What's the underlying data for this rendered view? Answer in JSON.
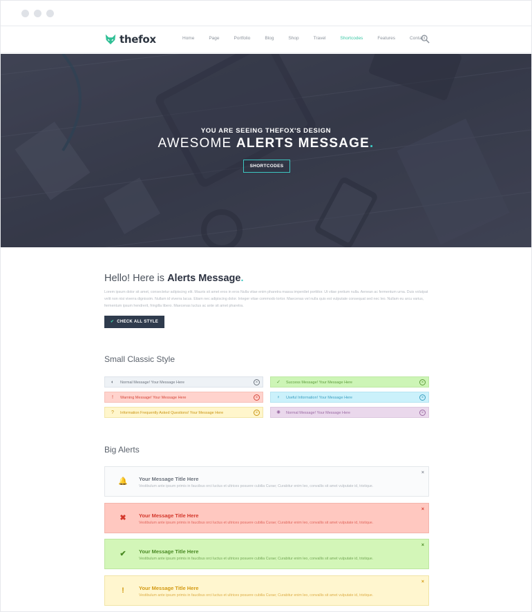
{
  "nav": {
    "logo_text": "thefox",
    "items": [
      "Home",
      "Page",
      "Portfolio",
      "Blog",
      "Shop",
      "Travel",
      "Shortcodes",
      "Features",
      "Contact"
    ],
    "active_index": 6
  },
  "hero": {
    "subtitle": "YOU ARE SEEING THEFOX'S DESIGN",
    "title_light": "AWESOME",
    "title_bold": "ALERTS MESSAGE",
    "title_dot": ".",
    "button_label": "SHORTCODES"
  },
  "intro": {
    "title_light": "Hello! Here is",
    "title_bold": "Alerts Message",
    "title_dot": ".",
    "text": "Lorem ipsum dolor sit amet, consectetur adipiscing elit. Mauris sit amet eros in eros Nulla vitae enim pharetra massa imperdiet porttitor. Ut vitae pretium nulla. Aenean ac fermentum urna. Duis volutpat velit non nisi viverra dignissim. Nullam id viverra lacus. Etiam nec adipiscing dolor. Integer vitae commodo tortor. Maecenas vel nulla quis est vulputate consequat sed nec leo. Nullam eu arcu varius, fermentum ipsum hendrerit, fringilla libero. Maecenas luctus ac ante sit amet pharetra.",
    "button_label": "CHECK ALL STYLE"
  },
  "small_section_title": "Small Classic Style",
  "small_alerts": [
    {
      "text": "Normal Message! Your Message Here",
      "icon": "speaker-icon",
      "bg": "#eef2f6",
      "border": "#dde3ea",
      "color": "#6b737d"
    },
    {
      "text": "Success Message! Your Message Here",
      "icon": "check-circle-icon",
      "bg": "#cdf5b6",
      "border": "#bde8a3",
      "color": "#5f9c3d"
    },
    {
      "text": "Warning Message! Your Message Here",
      "icon": "warning-circle-icon",
      "bg": "#ffd3cd",
      "border": "#f6c0b8",
      "color": "#d5463a"
    },
    {
      "text": "Useful Information! Your Message Here",
      "icon": "lightbulb-icon",
      "bg": "#cbf1fb",
      "border": "#b6e4f2",
      "color": "#3a9fc0"
    },
    {
      "text": "Information Frequently Asked Questions! Your Message Here",
      "icon": "question-icon",
      "bg": "#fff6cc",
      "border": "#f2e6a8",
      "color": "#c99414"
    },
    {
      "text": "Normal Message! Your Message Here",
      "icon": "gear-icon",
      "bg": "#ead8ec",
      "border": "#dcc7df",
      "color": "#9a6aa3"
    }
  ],
  "big_section_title": "Big Alerts",
  "big_alerts": [
    {
      "title": "Your Message Title Here",
      "text": "Vestibulum ante ipsum primis in faucibus orci luctus et ultrices posuere cubilia Curae; Curabitur enim leo, convallis sit amet vulputate id, tristique.",
      "icon": "bell-icon",
      "glyph": "🔔",
      "bg": "#fafbfc",
      "border": "#e4e7eb",
      "title_color": "#6a717b",
      "text_color": "#b0b6bd",
      "icon_color": "#8a9099",
      "close_color": "#8a9099"
    },
    {
      "title": "Your Message Title Here",
      "text": "Vestibulum ante ipsum primis in faucibus orci luctus et ultrices posuere cubilia Curae; Curabitur enim leo, convallis sit amet vulputate id, tristique.",
      "icon": "cross-icon",
      "glyph": "✖",
      "bg": "#ffc8c0",
      "border": "#f3b4ab",
      "title_color": "#d4382c",
      "text_color": "#e0665c",
      "icon_color": "#d4382c",
      "close_color": "#d4382c"
    },
    {
      "title": "Your Message Title Here",
      "text": "Vestibulum ante ipsum primis in faucibus orci luctus et ultrices posuere cubilia Curae; Curabitur enim leo, convallis sit amet vulputate id, tristique.",
      "icon": "check-icon",
      "glyph": "✔",
      "bg": "#d3f6b8",
      "border": "#bde6a0",
      "title_color": "#4a8a24",
      "text_color": "#74a855",
      "icon_color": "#4a8a24",
      "close_color": "#4a8a24"
    },
    {
      "title": "Your Message Title Here",
      "text": "Vestibulum ante ipsum primis in faucibus orci luctus et ultrices posuere cubilia Curae; Curabitur enim leo, convallis sit amet vulputate id, tristique.",
      "icon": "exclamation-icon",
      "glyph": "!",
      "bg": "#fff6cf",
      "border": "#f1e4a5",
      "title_color": "#d39a13",
      "text_color": "#ddae47",
      "icon_color": "#d39a13",
      "close_color": "#d39a13"
    }
  ],
  "close_glyph": "×"
}
